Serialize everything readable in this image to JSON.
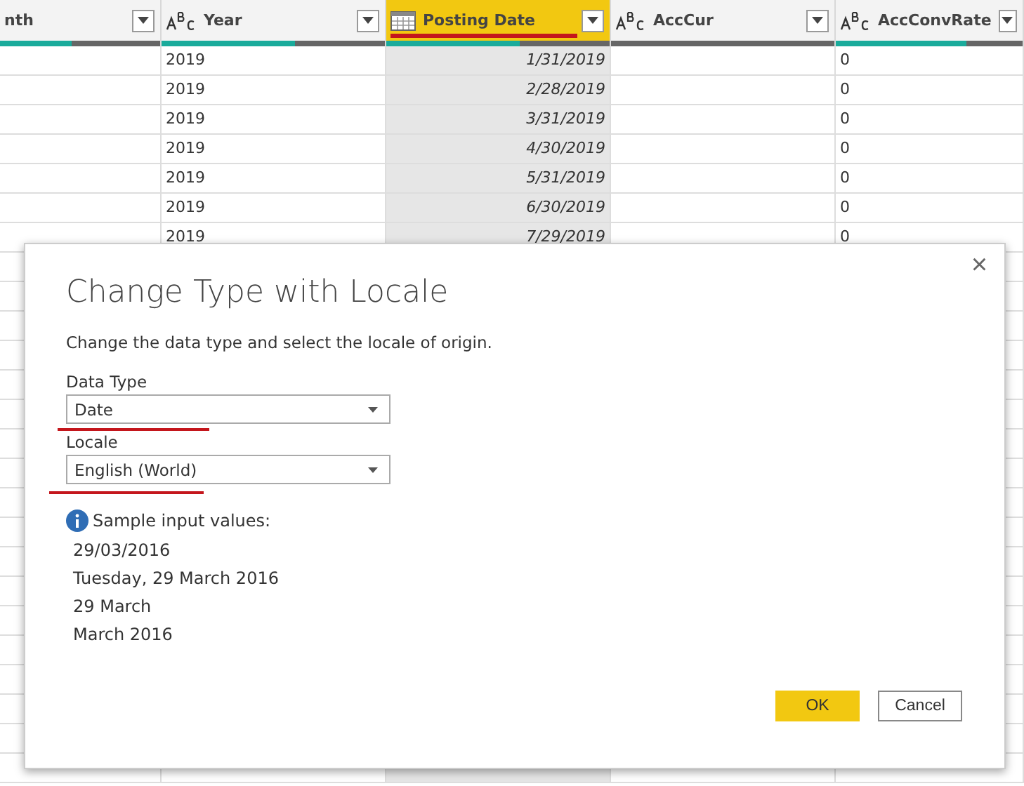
{
  "table": {
    "columns": [
      {
        "label": "nth",
        "kind": "plain",
        "selected": false,
        "level": 0.45
      },
      {
        "label": "Year",
        "kind": "text",
        "selected": false,
        "level": 0.6
      },
      {
        "label": "Posting Date",
        "kind": "date",
        "selected": true,
        "level": 0.6
      },
      {
        "label": "AccCur",
        "kind": "text",
        "selected": false
      },
      {
        "label": "AccConvRate",
        "kind": "text",
        "selected": false,
        "level": 0.7
      }
    ],
    "rows": [
      [
        "",
        "2019",
        "1/31/2019",
        "",
        "0"
      ],
      [
        "",
        "2019",
        "2/28/2019",
        "",
        "0"
      ],
      [
        "",
        "2019",
        "3/31/2019",
        "",
        "0"
      ],
      [
        "",
        "2019",
        "4/30/2019",
        "",
        "0"
      ],
      [
        "",
        "2019",
        "5/31/2019",
        "",
        "0"
      ],
      [
        "",
        "2019",
        "6/30/2019",
        "",
        "0"
      ],
      [
        "",
        "2019",
        "7/29/2019",
        "",
        "0"
      ]
    ]
  },
  "dialog": {
    "title": "Change Type with Locale",
    "description": "Change the data type and select the locale of origin.",
    "fields": [
      {
        "label": "Data Type",
        "value": "Date"
      },
      {
        "label": "Locale",
        "value": "English (World)"
      }
    ],
    "sample_heading": "Sample input values:",
    "samples": [
      "29/03/2016",
      "Tuesday, 29 March 2016",
      "29 March",
      "March 2016"
    ],
    "ok": "OK",
    "cancel": "Cancel",
    "close": "×"
  }
}
